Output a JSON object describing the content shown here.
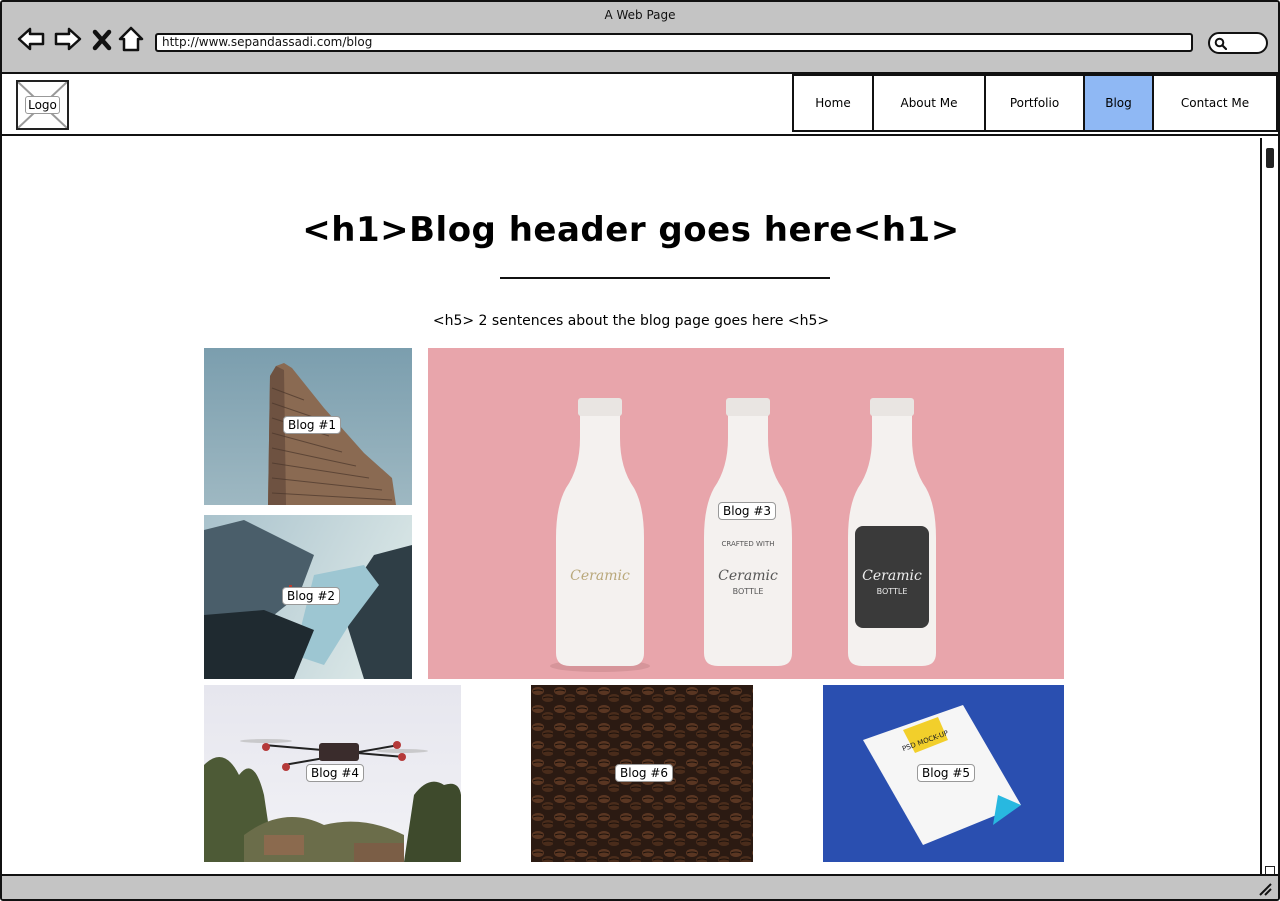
{
  "window": {
    "title": "A Web Page",
    "url": "http://www.sepandassadi.com/blog"
  },
  "header": {
    "logo_label": "Logo",
    "nav": [
      {
        "label": "Home",
        "active": false
      },
      {
        "label": "About Me",
        "active": false
      },
      {
        "label": "Portfolio",
        "active": false
      },
      {
        "label": "Blog",
        "active": true
      },
      {
        "label": "Contact Me",
        "active": false
      }
    ]
  },
  "main": {
    "heading": "<h1>Blog header goes here<h1>",
    "subheading": "<h5> 2 sentences about the blog page goes here <h5>"
  },
  "blogs": [
    {
      "label": "Blog #1",
      "image": "flatiron-building"
    },
    {
      "label": "Blog #2",
      "image": "fjord-cliff"
    },
    {
      "label": "Blog #3",
      "image": "ceramic-bottles"
    },
    {
      "label": "Blog #4",
      "image": "drone"
    },
    {
      "label": "Blog #6",
      "image": "coffee-beans"
    },
    {
      "label": "Blog #5",
      "image": "psd-mockup-paper"
    }
  ],
  "image_text": {
    "bottle_brand": "Ceramic",
    "bottle_sub": "BOTTLE",
    "bottle_crafted": "CRAFTED WITH",
    "mockup": "PSD MOCK-UP"
  },
  "colors": {
    "chrome": "#c4c4c4",
    "nav_active": "#8fb8f4",
    "bottle_bg": "#e8a5ab",
    "mockup_bg": "#2a4fb0"
  }
}
